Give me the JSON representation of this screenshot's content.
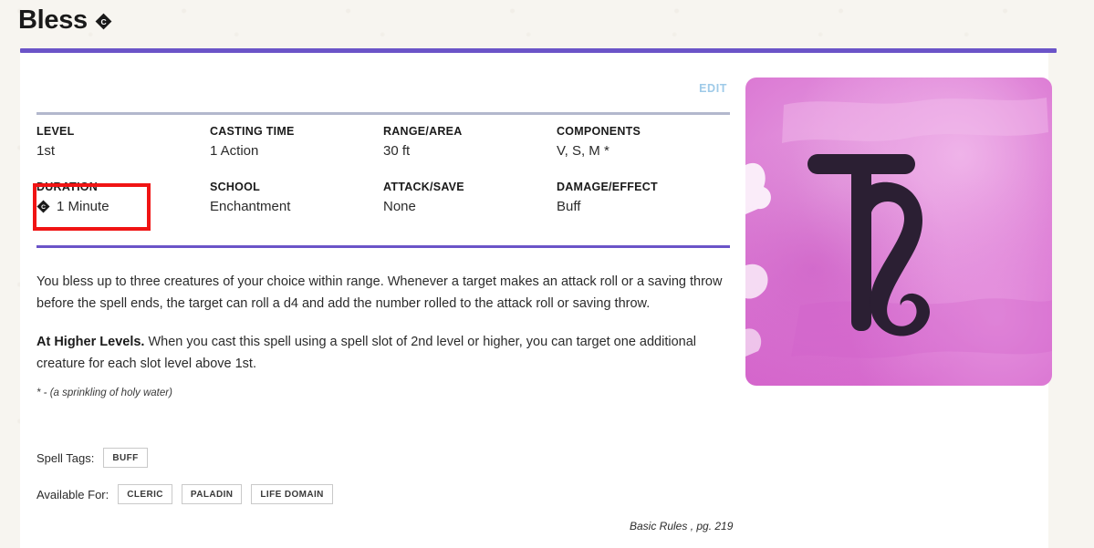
{
  "header": {
    "title": "Bless",
    "concentration_icon": "concentration-diamond-icon",
    "accent_color": "#6b54c8"
  },
  "toolbar": {
    "edit_label": "EDIT"
  },
  "stat_block": {
    "rows": [
      [
        {
          "label": "LEVEL",
          "value": "1st"
        },
        {
          "label": "CASTING TIME",
          "value": "1 Action"
        },
        {
          "label": "RANGE/AREA",
          "value": "30 ft"
        },
        {
          "label": "COMPONENTS",
          "value": "V, S, M *"
        }
      ],
      [
        {
          "label": "DURATION",
          "value": "1 Minute",
          "icon": "concentration-diamond-icon",
          "highlighted": true
        },
        {
          "label": "SCHOOL",
          "value": "Enchantment"
        },
        {
          "label": "ATTACK/SAVE",
          "value": "None"
        },
        {
          "label": "DAMAGE/EFFECT",
          "value": "Buff"
        }
      ]
    ],
    "highlight_color": "#f01414"
  },
  "description": {
    "paragraph_1": "You bless up to three creatures of your choice within range. Whenever a target makes an attack roll or a saving throw before the spell ends, the target can roll a d4 and add the number rolled to the attack roll or saving throw.",
    "higher_levels_label": "At Higher Levels.",
    "higher_levels_text": " When you cast this spell using a spell slot of 2nd level or higher, you can target one additional creature for each slot level above 1st.",
    "footnote": "* - (a sprinkling of holy water)"
  },
  "tags": {
    "spell_tags_label": "Spell Tags:",
    "spell_tags": [
      "BUFF"
    ],
    "available_for_label": "Available For:",
    "available_for": [
      "CLERIC",
      "PALADIN",
      "LIFE DOMAIN"
    ]
  },
  "source": "Basic Rules , pg. 219",
  "spell_art": {
    "name": "enchantment-school-symbol",
    "background_color": "#dd7fd6",
    "symbol_color": "#2b1f33"
  }
}
